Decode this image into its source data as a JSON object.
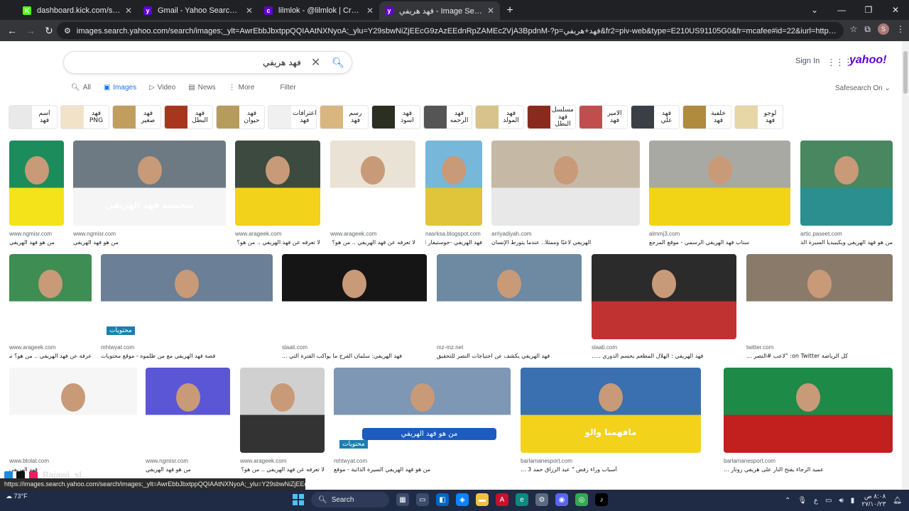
{
  "browser": {
    "tabs": [
      {
        "label": "dashboard.kick.com/stream",
        "fav": "K",
        "fav_color": "#53fc18",
        "active": false
      },
      {
        "label": "Gmail - Yahoo Search Results",
        "fav": "y",
        "fav_color": "#6001d2",
        "active": false
      },
      {
        "label": "lilmlok - @lilmlok | Creators",
        "fav": "c",
        "fav_color": "#6001d2",
        "active": false
      },
      {
        "label": "فهد هريفي - Image Search Results",
        "fav": "y",
        "fav_color": "#6001d2",
        "active": true
      }
    ],
    "url": "images.search.yahoo.com/search/images;_ylt=AwrEbbJbxtppQQIAAtNXNyoA;_ylu=Y29sbwNiZjEEcG9zAzEEdnRpZAMEc2VjA3BpdnM-?p=فهد+هريفي&fr2=piv-web&type=E210US91105G0&fr=mcafee#id=22&iurl=https%3A%2F%2Fwww.almowaten.net%2..."
  },
  "search": {
    "query": "فهد هريفي",
    "sign_in": "Sign In",
    "logo": "yahoo!",
    "tabs": [
      "All",
      "Images",
      "Video",
      "News",
      "More"
    ],
    "filter": "Filter",
    "safesearch": "Safesearch On"
  },
  "chips": [
    {
      "label": "اسم فهد",
      "color": "#e9e9e9"
    },
    {
      "label": "فهد PNG",
      "color": "#f2e3c8"
    },
    {
      "label": "فهد صغير",
      "color": "#c29e5e"
    },
    {
      "label": "فهد البطل",
      "color": "#a8361f"
    },
    {
      "label": "فهد حيوان",
      "color": "#b79b5d"
    },
    {
      "label": "اعترافات فهد",
      "color": "#f0f0f0"
    },
    {
      "label": "رسم فهد",
      "color": "#d9b680"
    },
    {
      "label": "فهد اسود",
      "color": "#2a2f22"
    },
    {
      "label": "فهد الرحمه",
      "color": "#555"
    },
    {
      "label": "فهد المولد",
      "color": "#d7c38b"
    },
    {
      "label": "مسلسل فهد البطل",
      "color": "#8a2a1f"
    },
    {
      "label": "الامير فهد",
      "color": "#c14e4e"
    },
    {
      "label": "فهد علي",
      "color": "#3a3f45"
    },
    {
      "label": "خلفية فهد",
      "color": "#b08a3e"
    },
    {
      "label": "لوجو فهد",
      "color": "#e7d7a6"
    }
  ],
  "rows": [
    [
      {
        "src": "www.ngmisr.com",
        "cap": "من هو فهد الهريفي",
        "bg": "#1c8c5c",
        "fg": "#f4e21a"
      },
      {
        "src": "www.ngmisr.com",
        "cap": "من هو فهد الهريفي",
        "bg": "#6e7a83",
        "fg": "#f5f5f5",
        "overlay": "شخصية فهد الهريفي"
      },
      {
        "src": "www.arageek.com",
        "cap": "لا تعرفه عن فهد الهريفي .. من هو؟ سيرته",
        "bg": "#3d4a3f",
        "fg": "#f2d21a"
      },
      {
        "src": "www.arageek.com",
        "cap": "لا تعرفه عن فهد الهريفي .. من هو؟ سيرته",
        "bg": "#e9e2d5",
        "fg": "#ffffff"
      },
      {
        "src": "nasrksa.blogspot.com",
        "cap": "فهد الهريفي -جوستيفار العرب",
        "bg": "#77b7d9",
        "fg": "#e0c43a"
      },
      {
        "src": "arriyadiyah.com",
        "cap": "الهريفي لاعبًا وممثلًا.. عندما يتورط الإنسان",
        "bg": "#c5b9a6",
        "fg": "#e8e8e8"
      },
      {
        "src": "almmj3.com",
        "cap": "سناب فهد الهريفي الرسمي - موقع المرجع",
        "bg": "#a9a9a3",
        "fg": "#f1d416"
      },
      {
        "src": "artic.paseet.com",
        "cap": "من هو فهد الهريفي ويكيبيديا السيرة الذاتية ...",
        "bg": "#48875f",
        "fg": "#2a8f8e"
      }
    ],
    [
      {
        "src": "www.arageek.com",
        "cap": "عرفه عن فهد الهريفي .. من هو؟ سيرته",
        "bg": "#3e8d52",
        "fg": "#ffffff"
      },
      {
        "src": "mhtwyat.com",
        "cap": "قصة فهد الهريفي مع من ظلموه - موقع محتويات",
        "bg": "#6b7f96",
        "fg": "#ffffff",
        "overlay": "قصة فهد الهريفي مع من ظلموه",
        "badge": "محتويات"
      },
      {
        "src": "slaati.com",
        "cap": "فهد الهريفي: سلمان الفرج ما يواكب الفترة التي ...",
        "bg": "#151515",
        "fg": "#ffffff"
      },
      {
        "src": "mz-mz.net",
        "cap": "فهد الهريفي يكشف عن احتياجات النصر للتحقيق",
        "bg": "#6e8aa3",
        "fg": "#ffffff"
      },
      {
        "src": "slaati.com",
        "cap": "فهد الهريفي : الهلال المطعم بحسم الدوري .....",
        "bg": "#2b2b2b",
        "fg": "#c03232"
      },
      {
        "src": "twitter.com",
        "cap": "كل الرياضة on Twitter: \"لاعب #النصر ...",
        "bg": "#8a7a6a",
        "fg": "#ffffff"
      }
    ],
    [
      {
        "src": "www.btolat.com",
        "cap": "فهد الهريفي",
        "bg": "#f6f6f6",
        "fg": "#ffffff"
      },
      {
        "src": "www.ngmisr.com",
        "cap": "من هو فهد الهريفي",
        "bg": "#5a56d6",
        "fg": "#ffffff"
      },
      {
        "src": "www.arageek.com",
        "cap": "لا تعرفه عن فهد الهريفي .. من هو؟ سيرته",
        "bg": "#d0d0d0",
        "fg": "#333333"
      },
      {
        "src": "mhtwyat.com",
        "cap": "من هو فهد الهريفي السيرة الذاتية - موقع",
        "bg": "#7d97b4",
        "fg": "#ffffff",
        "banner": "من هو فهد الهريفي",
        "badge": "محتويات"
      },
      {
        "src": "barlamanesport.com",
        "cap": "أسباب وراء رفض \" عبد الرزاق حمد 3 ...",
        "bg": "#3a6fb0",
        "fg": "#f2d21a",
        "overlay": "مافهمنا والو"
      },
      {
        "src": "barlamanesport.com",
        "cap": "عميد الرجاء يفتح النار على هريفي رونار ...",
        "bg": "#1e8a48",
        "fg": "#c21f1f"
      }
    ]
  ],
  "statusbar": "https://images.search.yahoo.com/search/images;_ylt=AwrEbbJbxtppQQIAAtNXNyoA;_ylu=Y29sbwNiZjEEcG9zAzEEdnRpZAMEc2VjA3NjNyBHNsawNpbWcEb2lkAzYwZmM0YTBlZjIzZWRl...",
  "stream_overlay": {
    "username": "Rajawi_sl"
  },
  "taskbar": {
    "weather": "73°F",
    "search": "Search",
    "clock_time": "٨:٠٨ ص",
    "clock_date": "٢٧/١٠/٢٣",
    "lang": "ع"
  }
}
